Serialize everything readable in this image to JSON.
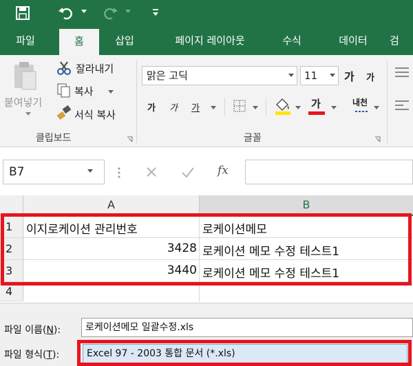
{
  "ribbon_tabs": [
    "파일",
    "홈",
    "삽입",
    "페이지 레이아웃",
    "수식",
    "데이터",
    "검"
  ],
  "clipboard": {
    "paste_label": "붙여넣기",
    "cut_label": "잘라내기",
    "copy_label": "복사",
    "format_painter_label": "서식 복사",
    "group_label": "클립보드"
  },
  "font": {
    "font_name": "맑은 고딕",
    "font_size": "11",
    "grow_label": "가",
    "shrink_label": "가",
    "bold_label": "가",
    "italic_label": "가",
    "underline_label": "가",
    "font_color_label": "가",
    "phonetic_label": "내천",
    "group_label": "글꼴"
  },
  "formula_bar": {
    "name_box": "B7",
    "fx_label": "fx",
    "value": ""
  },
  "sheet": {
    "columns": [
      "A",
      "B"
    ],
    "row_numbers": [
      "1",
      "2",
      "3",
      "4"
    ],
    "rows": [
      [
        "이지로케이션 관리번호",
        "로케이션메모"
      ],
      [
        "3428",
        "로케이션 메모 수정 테스트1"
      ],
      [
        "3440",
        "로케이션 메모 수정 테스트1"
      ],
      [
        "",
        ""
      ]
    ]
  },
  "save_dialog": {
    "file_name_label": "파일 이름(",
    "file_name_key": "N",
    "file_name_suffix": "):",
    "file_name_value": "로케이션메모 일괄수정.xls",
    "file_type_label": "파일 형식(",
    "file_type_key": "T",
    "file_type_suffix": "):",
    "file_type_value": "Excel 97 - 2003 통합 문서 (*.xls)"
  },
  "colors": {
    "excel_green": "#217346",
    "highlight_red": "#e8141d",
    "highlight_yellow": "#ffe600"
  }
}
